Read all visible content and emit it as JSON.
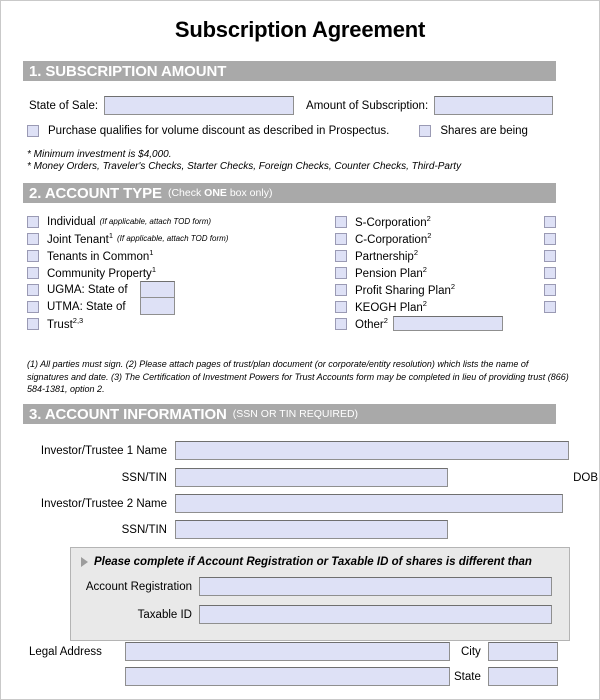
{
  "document": {
    "title": "Subscription Agreement"
  },
  "section1": {
    "number_title": "1. SUBSCRIPTION AMOUNT",
    "state_of_sale_label": "State of Sale:",
    "state_of_sale_value": "",
    "amount_label": "Amount of Subscription:",
    "amount_value": "",
    "volume_discount_label": "Purchase qualifies for volume discount as described in Prospectus.",
    "shares_being_label": "Shares are being",
    "notes": [
      "* Minimum investment is $4,000.",
      "* Money Orders, Traveler's Checks, Starter Checks, Foreign Checks, Counter Checks, Third-Party"
    ]
  },
  "section2": {
    "number_title": "2. ACCOUNT TYPE",
    "subtitle_pre": "(Check ",
    "subtitle_bold": "ONE",
    "subtitle_post": " box only)",
    "left_options": [
      {
        "label": "Individual",
        "sup": "",
        "note": "(If applicable, attach TOD form)"
      },
      {
        "label": "Joint Tenant",
        "sup": "1",
        "note": "(If applicable, attach TOD form)"
      },
      {
        "label": "Tenants in Common",
        "sup": "1",
        "note": ""
      },
      {
        "label": "Community Property",
        "sup": "1",
        "note": ""
      },
      {
        "label": "UGMA: State of",
        "sup": "",
        "note": ""
      },
      {
        "label": "UTMA: State of",
        "sup": "",
        "note": ""
      },
      {
        "label": "Trust",
        "sup": "2,3",
        "note": ""
      }
    ],
    "ugma_state_value": "",
    "utma_state_value": "",
    "right_options": [
      {
        "label": "S-Corporation",
        "sup": "2"
      },
      {
        "label": "C-Corporation",
        "sup": "2"
      },
      {
        "label": "Partnership",
        "sup": "2"
      },
      {
        "label": "Pension Plan",
        "sup": "2"
      },
      {
        "label": "Profit Sharing Plan",
        "sup": "2"
      },
      {
        "label": "KEOGH Plan",
        "sup": "2"
      },
      {
        "label": "Other",
        "sup": "2"
      }
    ],
    "other_value": "",
    "far_column_checkbox_count": 6
  },
  "footnotes": {
    "text": "(1) All parties must sign. (2) Please attach pages of trust/plan document (or corporate/entity resolution) which lists the name of signatures and date. (3) The Certification of Investment Powers for Trust Accounts form may be completed in lieu of providing trust (866) 584-1381, option 2."
  },
  "section3": {
    "number_title": "3. ACCOUNT INFORMATION",
    "subtitle": "(SSN OR TIN REQUIRED)",
    "fields": {
      "investor1_name_label": "Investor/Trustee 1 Name",
      "investor1_name_value": "",
      "ssn1_label": "SSN/TIN",
      "ssn1_value": "",
      "dob_label": "DOB",
      "dob_value": "",
      "investor2_name_label": "Investor/Trustee 2 Name",
      "investor2_name_value": "",
      "ssn2_label": "SSN/TIN",
      "ssn2_value": ""
    },
    "subpanel": {
      "title": "Please complete if Account Registration or Taxable ID of shares is different than",
      "account_registration_label": "Account Registration",
      "account_registration_value": "",
      "taxable_id_label": "Taxable ID",
      "taxable_id_value": ""
    },
    "address": {
      "legal_address_label": "Legal Address",
      "legal_address_line1": "",
      "legal_address_line2": "",
      "city_label": "City",
      "city_value": "",
      "state_label": "State",
      "state_value": ""
    }
  },
  "colors": {
    "section_bar": "#a9a9a9",
    "field_fill": "#dee1f6",
    "field_border": "#8f8f8f",
    "subpanel_fill": "#e9e9e9",
    "page_border": "#c9c9c9"
  }
}
